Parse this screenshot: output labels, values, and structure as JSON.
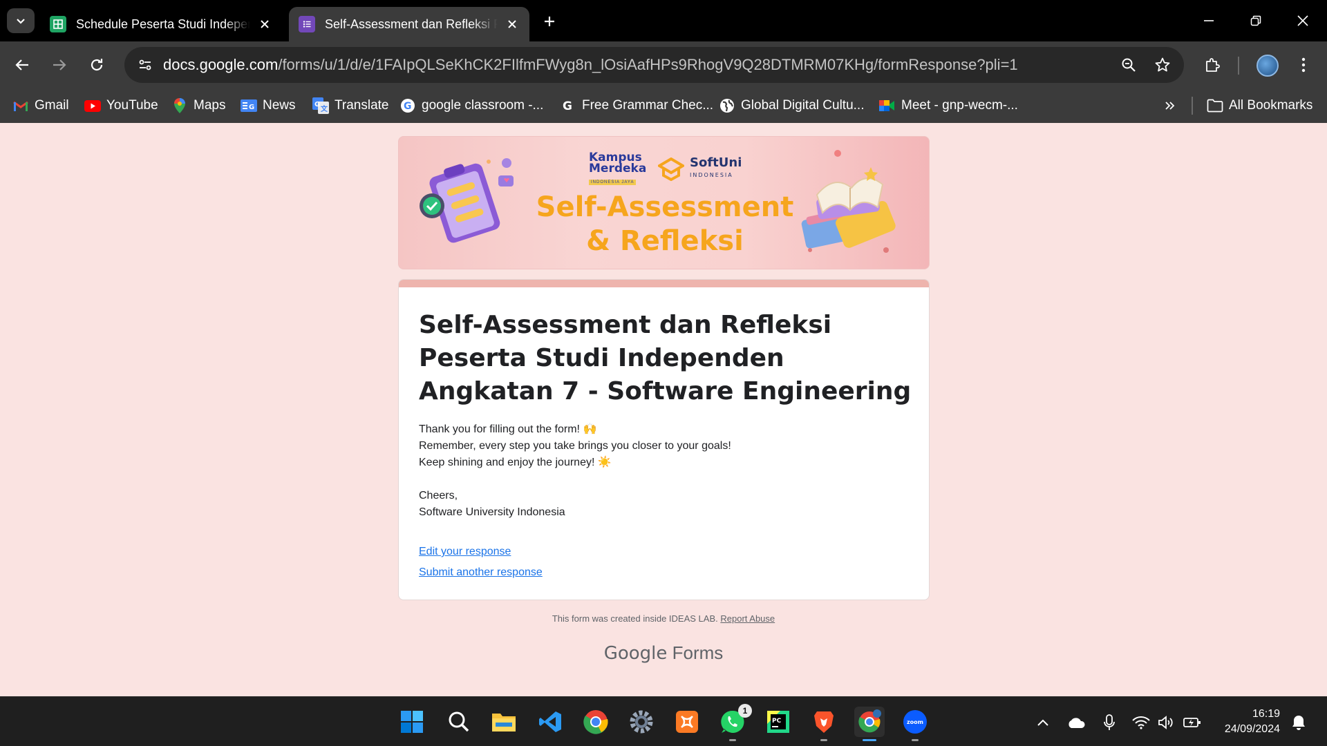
{
  "tabs": [
    {
      "title": "Schedule Peserta Studi Independen",
      "favicon": "google-sheets-icon",
      "color": "#1fa463"
    },
    {
      "title": "Self-Assessment dan Refleksi Peserta Studi Independen",
      "favicon": "google-forms-icon",
      "color": "#7248b9"
    }
  ],
  "address_bar": {
    "host": "docs.google.com",
    "path": "/forms/u/1/d/e/1FAIpQLSeKhCK2FIlfmFWyg8n_lOsiAafHPs9RhogV9Q28DTMRM07KHg/formResponse?pli=1"
  },
  "bookmarks": [
    {
      "label": "Gmail",
      "icon": "gmail-icon"
    },
    {
      "label": "YouTube",
      "icon": "youtube-icon"
    },
    {
      "label": "Maps",
      "icon": "maps-icon"
    },
    {
      "label": "News",
      "icon": "news-icon"
    },
    {
      "label": "Translate",
      "icon": "translate-icon"
    },
    {
      "label": "google classroom -...",
      "icon": "google-icon"
    },
    {
      "label": "Free Grammar Chec...",
      "icon": "grammarly-icon"
    },
    {
      "label": "Global Digital Cultu...",
      "icon": "globe-icon"
    },
    {
      "label": "Meet - gnp-wecm-...",
      "icon": "meet-icon"
    }
  ],
  "all_bookmarks_label": "All Bookmarks",
  "banner": {
    "logo_kampus": "Kampus Merdeka",
    "logo_kampus_sub": "INDONESIA JAYA",
    "logo_softuni": "SoftUni",
    "logo_softuni_sub": "INDONESIA",
    "title_line1": "Self-Assessment",
    "title_line2": "& Refleksi"
  },
  "form": {
    "title": "Self-Assessment dan Refleksi Peserta Studi Independen Angkatan 7 - Software Engineering",
    "message_lines": [
      "Thank you for filling out the form! 🙌",
      "Remember, every step you take brings you closer to your goals!",
      "Keep shining and enjoy the journey! ☀️",
      "",
      "Cheers,",
      "Software University Indonesia"
    ],
    "edit_link": "Edit your response",
    "submit_another_link": "Submit another response"
  },
  "footer": {
    "created_text": "This form was created inside IDEAS LAB.",
    "report_link": "Report Abuse",
    "brand_google": "Google",
    "brand_forms": "Forms"
  },
  "taskbar": {
    "apps": [
      "windows-start-icon",
      "search-icon",
      "file-explorer-icon",
      "vscode-icon",
      "chrome-icon",
      "settings-icon",
      "xampp-icon",
      "whatsapp-icon",
      "pycharm-icon",
      "brave-icon",
      "chrome-profile-icon",
      "zoom-icon"
    ],
    "whatsapp_badge": "1",
    "zoom_label": "zoom",
    "time": "16:19",
    "date": "24/09/2024"
  }
}
